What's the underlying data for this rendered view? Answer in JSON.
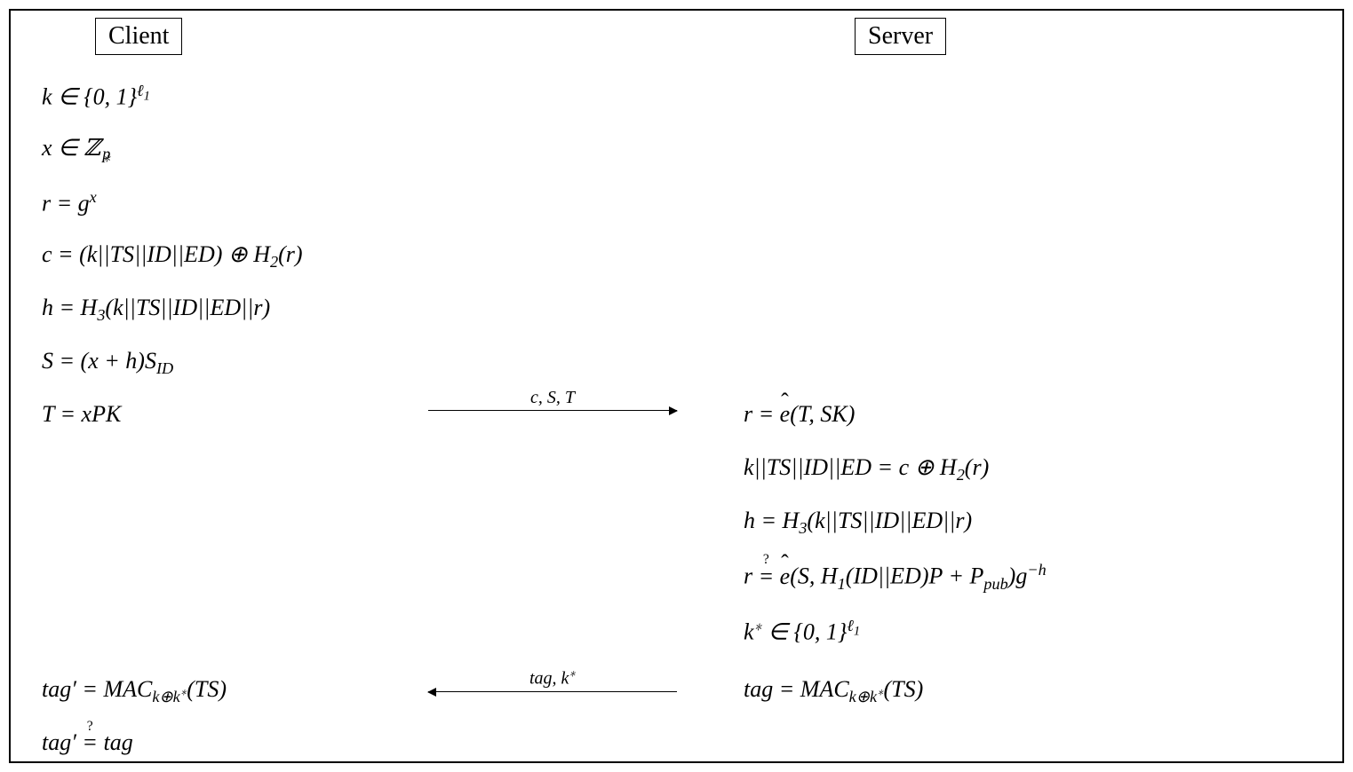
{
  "parties": {
    "client": "Client",
    "server": "Server"
  },
  "client_steps": {
    "s1": "k ∈ {0, 1}^ℓ₁",
    "s2": "x ∈ ℤ*_p",
    "s3": "r = g^x",
    "s4": "c = (k||TS||ID||ED) ⊕ H₂(r)",
    "s5": "h = H₃(k||TS||ID||ED||r)",
    "s6": "S = (x + h)S_ID",
    "s7": "T = xPK",
    "s8": "tag′ = MAC_{k⊕k*}(TS)",
    "s9": "tag′ ?= tag"
  },
  "server_steps": {
    "s1": "r = ê(T, SK)",
    "s2": "k||TS||ID||ED = c ⊕ H₂(r)",
    "s3": "h = H₃(k||TS||ID||ED||r)",
    "s4": "r ?= ê(S, H₁(ID||ED)P + P_pub)g^−h",
    "s5": "k* ∈ {0, 1}^ℓ₁",
    "s6": "tag = MAC_{k⊕k*}(TS)"
  },
  "arrows": {
    "a1": "c, S, T",
    "a2": "tag, k*"
  }
}
